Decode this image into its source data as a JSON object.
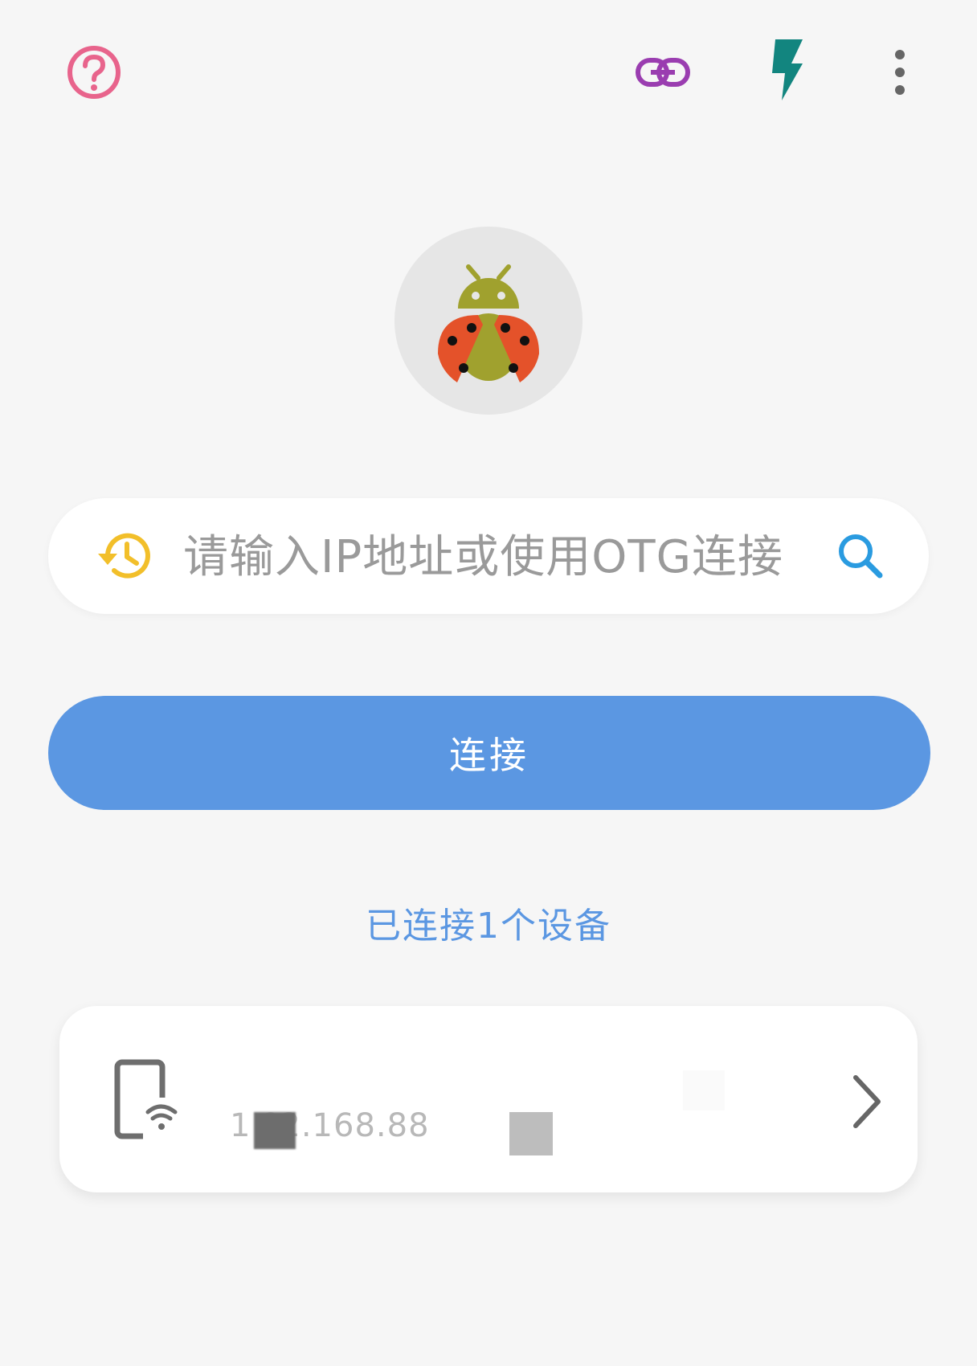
{
  "toolbar": {
    "help_icon": "help-circle-icon",
    "link_icon": "link-icon",
    "flash_icon": "flash-icon",
    "more_icon": "more-vertical-icon"
  },
  "logo": {
    "icon": "ladybug-android-icon"
  },
  "search": {
    "placeholder": "请输入IP地址或使用OTG连接",
    "value": "",
    "history_icon": "history-icon",
    "search_icon": "search-icon"
  },
  "connect": {
    "label": "连接"
  },
  "status": {
    "connected_count": "已连接1个设备"
  },
  "device": {
    "icon": "phone-wifi-icon",
    "ip_visible": "1 ?2.168.88",
    "chevron_icon": "chevron-right-icon"
  },
  "colors": {
    "background": "#f6f6f6",
    "accent_blue": "#5b97e2",
    "help_pink": "#e8648c",
    "link_purple": "#9a3db0",
    "flash_teal": "#12857f",
    "history_yellow": "#f2bf2a",
    "search_blue": "#2a9be0",
    "ladybug_red": "#e4522a",
    "android_olive": "#a0a12e"
  }
}
